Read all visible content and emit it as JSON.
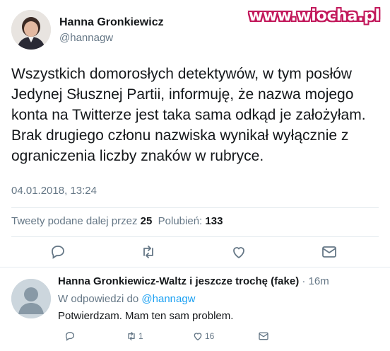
{
  "watermark": "www.wiocha.pl",
  "tweet": {
    "author_name": "Hanna Gronkiewicz",
    "author_handle": "@hannagw",
    "text_lines": [
      "Wszystkich domorosłych detektywów, w tym posłów",
      "Jedynej Słusznej Partii, informuję, że nazwa mojego",
      "konta na Twitterze jest taka sama odkąd je założyłam.",
      "Brak drugiego członu nazwiska wynikał wyłącznie z",
      "ograniczenia liczby znaków w rubryce."
    ],
    "date": "04.01.2018, 13:24",
    "retweets_label": "Tweety podane dalej przez",
    "retweets_count": "25",
    "likes_label": "Polubień:",
    "likes_count": "133",
    "icons": [
      "reply-icon",
      "retweet-icon",
      "like-icon",
      "message-icon"
    ]
  },
  "reply": {
    "author_name": "Hanna Gronkiewicz-Waltz i jeszcze trochę (fake)",
    "time": "· 16m",
    "reply_to_label": "W odpowiedzi do",
    "reply_to_handle": "@hannagw",
    "text": "Potwierdzam. Mam ten sam problem.",
    "retweet_count": "1",
    "like_count": "16",
    "icons": [
      "reply-icon",
      "retweet-icon",
      "like-icon",
      "message-icon"
    ]
  },
  "colors": {
    "text": "#14171a",
    "secondary": "#657786",
    "link": "#1da1f2",
    "separator": "#e6ecf0",
    "watermark_outline": "#c2185b"
  }
}
